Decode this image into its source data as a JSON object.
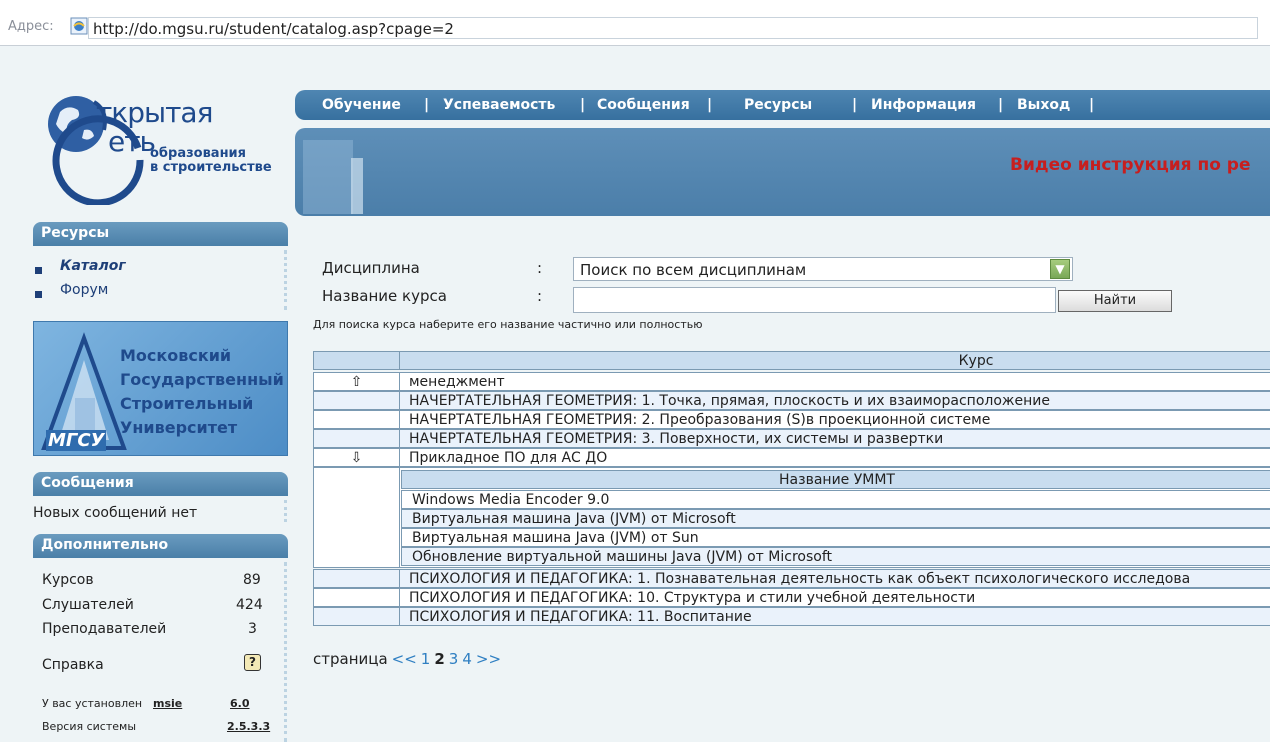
{
  "address_bar": {
    "label": "Адрес:",
    "url": "http://do.mgsu.ru/student/catalog.asp?cpage=2"
  },
  "logo": {
    "line1": "ткрытая",
    "line2": "еть",
    "line3": "образования",
    "line4": "в строительстве"
  },
  "nav": {
    "items": [
      "Обучение",
      "Успеваемость",
      "Сообщения",
      "Ресурсы",
      "Информация",
      "Выход"
    ],
    "separator": "|"
  },
  "hero": {
    "text": "Видео инструкция по ре"
  },
  "sidebar": {
    "resources_title": "Ресурсы",
    "resources_items": [
      {
        "label": "Каталог"
      },
      {
        "label": "Форум"
      }
    ],
    "university": {
      "line1": "Московский",
      "line2": "Государственный",
      "line3": "Строительный",
      "line4": "Университет",
      "abbr": "МГСУ"
    },
    "messages_title": "Сообщения",
    "messages_text": "Новых сообщений нет",
    "extra_title": "Дополнительно",
    "stats": [
      {
        "label": "Курсов",
        "value": "89"
      },
      {
        "label": "Слушателей",
        "value": "424"
      },
      {
        "label": "Преподавателей",
        "value": "3"
      }
    ],
    "help_label": "Справка",
    "browser_label": "У вас установлен",
    "browser_name": "msie",
    "browser_version": "6.0",
    "system_label": "Версия системы",
    "system_version": "2.5.3.3"
  },
  "search": {
    "discipline_label": "Дисциплина",
    "course_label": "Название курса",
    "colon": ":",
    "discipline_value": "Поиск по всем дисциплинам",
    "course_value": "",
    "find_button": "Найти",
    "hint": "Для поиска курса наберите его название частично или полностью"
  },
  "table": {
    "header": "Курс",
    "rows": [
      {
        "arrow": "⇧",
        "name": "менеджмент"
      },
      {
        "arrow": "",
        "name": "НАЧЕРТАТЕЛЬНАЯ ГЕОМЕТРИЯ: 1. Точка, прямая, плоскость и их взаиморасположение"
      },
      {
        "arrow": "",
        "name": "НАЧЕРТАТЕЛЬНАЯ ГЕОМЕТРИЯ: 2. Преобразования (S)в проекционной системе"
      },
      {
        "arrow": "",
        "name": "НАЧЕРТАТЕЛЬНАЯ ГЕОМЕТРИЯ: 3. Поверхности, их системы и развертки"
      },
      {
        "arrow": "⇩",
        "name": "Прикладное ПО для АС ДО"
      }
    ],
    "sub_header": "Название УММТ",
    "sub_rows": [
      "Windows Media Encoder 9.0",
      "Виртуальная машина Java (JVM) от Microsoft",
      "Виртуальная машина Java (JVM) от Sun",
      "Обновление виртуальной машины Java (JVM) от Microsoft"
    ],
    "rows_after": [
      "ПСИХОЛОГИЯ И ПЕДАГОГИКА: 1. Познавательная деятельность как объект психологического исследова",
      "ПСИХОЛОГИЯ И ПЕДАГОГИКА: 10. Структура и стили учебной деятельности",
      "ПСИХОЛОГИЯ И ПЕДАГОГИКА: 11. Воспитание"
    ]
  },
  "pager": {
    "label": "страница",
    "prev": "<<",
    "pages": [
      "1",
      "2",
      "3",
      "4"
    ],
    "current": "2",
    "next": ">>"
  }
}
